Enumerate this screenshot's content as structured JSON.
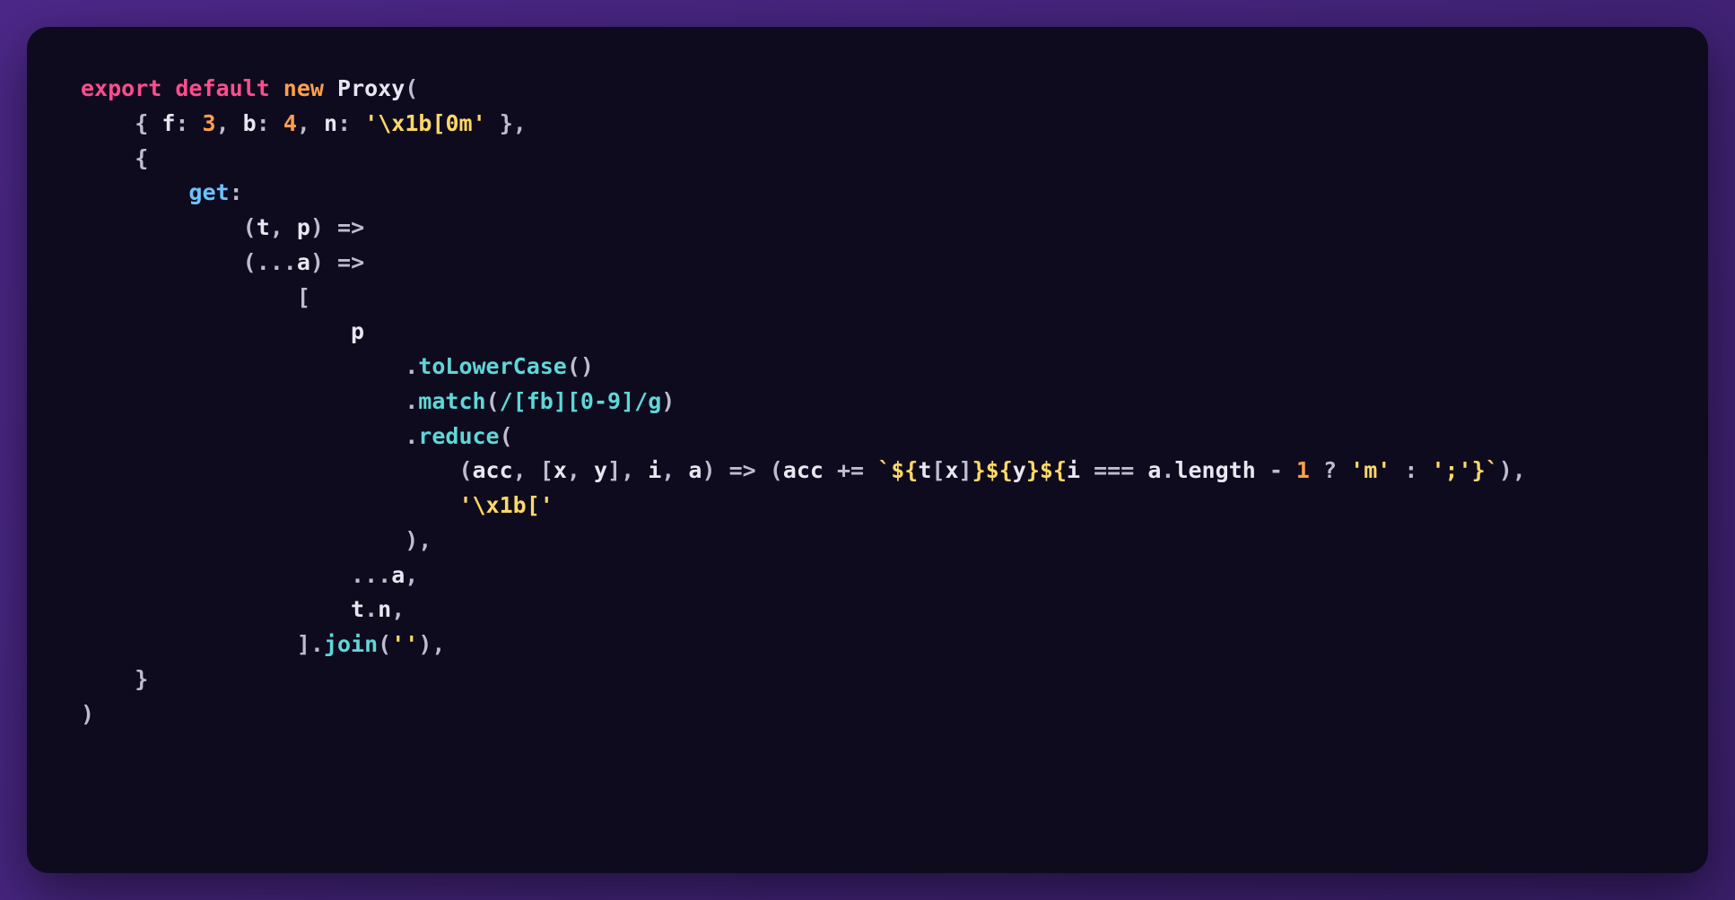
{
  "code": {
    "line1": {
      "export": "export",
      "default": "default",
      "new": "new",
      "proxy": "Proxy",
      "open": "("
    },
    "line2": {
      "indent": "    ",
      "open": "{ ",
      "k1": "f",
      "c1": ": ",
      "v1": "3",
      "s1": ", ",
      "k2": "b",
      "c2": ": ",
      "v2": "4",
      "s2": ", ",
      "k3": "n",
      "c3": ": ",
      "v3": "'\\x1b[0m'",
      "close": " },"
    },
    "line3": {
      "indent": "    ",
      "open": "{"
    },
    "line4": {
      "indent": "        ",
      "key": "get",
      "colon": ":"
    },
    "line5": {
      "indent": "            ",
      "open": "(",
      "p1": "t",
      "s1": ", ",
      "p2": "p",
      "close": ") ",
      "arrow": "=>"
    },
    "line6": {
      "indent": "            ",
      "open": "(",
      "spread": "...",
      "p1": "a",
      "close": ") ",
      "arrow": "=>"
    },
    "line7": {
      "indent": "                ",
      "bracket": "["
    },
    "line8": {
      "indent": "                    ",
      "id": "p"
    },
    "line9": {
      "indent": "                        ",
      "dot": ".",
      "method": "toLowerCase",
      "call": "()"
    },
    "line10": {
      "indent": "                        ",
      "dot": ".",
      "method": "match",
      "open": "(",
      "regex": "/[fb][0-9]/g",
      "close": ")"
    },
    "line11": {
      "indent": "                        ",
      "dot": ".",
      "method": "reduce",
      "open": "("
    },
    "line12": {
      "indent": "                            ",
      "open": "(",
      "p1": "acc",
      "s1": ", ",
      "openb": "[",
      "p2": "x",
      "s2": ", ",
      "p3": "y",
      "closeb": "]",
      "s3": ", ",
      "p4": "i",
      "s4": ", ",
      "p5": "a",
      "close": ") ",
      "arrow": "=> ",
      "open2": "(",
      "id1": "acc",
      "op1": " += ",
      "tmpl_open": "`",
      "exp1_open": "${",
      "exp1_id": "t",
      "exp1_br": "[",
      "exp1_x": "x",
      "exp1_brc": "]",
      "exp1_close": "}",
      "exp2_open": "${",
      "exp2_id": "y",
      "exp2_close": "}",
      "exp3_open": "${",
      "exp3_id1": "i",
      "exp3_op1": " === ",
      "exp3_id2": "a",
      "exp3_dot": ".",
      "exp3_prop": "length",
      "exp3_op2": " - ",
      "exp3_num": "1",
      "exp3_q": " ? ",
      "exp3_s1": "'m'",
      "exp3_c": " : ",
      "exp3_s2": "';'",
      "exp3_close": "}",
      "tmpl_close": "`",
      "close2": "),"
    },
    "line13": {
      "indent": "                            ",
      "str": "'\\x1b['"
    },
    "line14": {
      "indent": "                        ",
      "close": "),"
    },
    "line15": {
      "indent": "                    ",
      "spread": "...",
      "id": "a",
      "comma": ","
    },
    "line16": {
      "indent": "                    ",
      "id1": "t",
      "dot": ".",
      "id2": "n",
      "comma": ","
    },
    "line17": {
      "indent": "                ",
      "close": "].",
      "method": "join",
      "open": "(",
      "str": "''",
      "close2": "),"
    },
    "line18": {
      "indent": "    ",
      "close": "}"
    },
    "line19": {
      "close": ")"
    }
  }
}
